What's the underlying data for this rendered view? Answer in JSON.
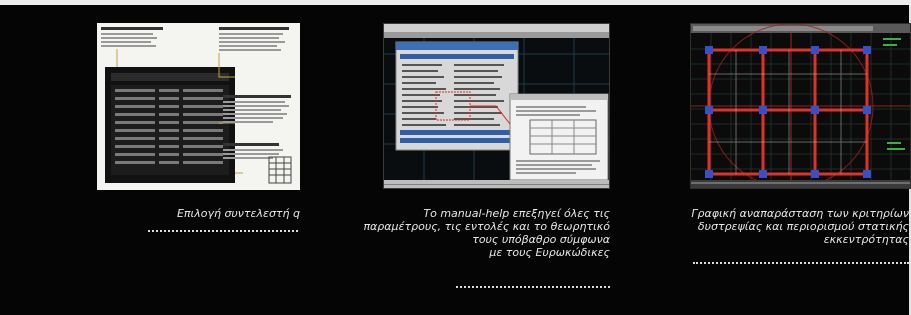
{
  "colors": {
    "background": "#050505",
    "caption_text": "#e8e8e8",
    "dotted_rule": "#dcdcdc",
    "cad_red": "#e0302a",
    "cad_node": "#3550c8",
    "dialog_title": "#3d6fb5"
  },
  "cards": [
    {
      "image_icon": "document-page-icon",
      "caption_lines": [
        "Επιλογή συντελεστή q"
      ]
    },
    {
      "image_icon": "software-window-icon",
      "caption_lines": [
        "Το manual-help επεξηγεί όλες τις",
        "παραμέτρους, τις εντολές και το θεωρητικό",
        "τους υπόβαθρο σύμφωνα",
        "με τους Ευρωκώδικες"
      ]
    },
    {
      "image_icon": "cad-plan-icon",
      "caption_lines": [
        "Γραφική αναπαράσταση των κριτηρίων",
        "δυστρεψίας και περιορισμού στατικής",
        "εκκεντρότητας"
      ]
    }
  ]
}
